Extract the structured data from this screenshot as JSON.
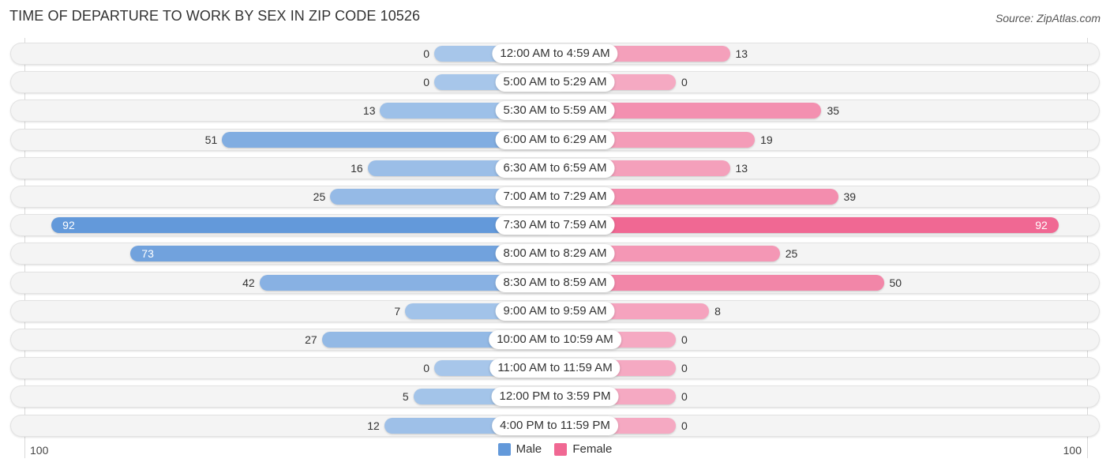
{
  "header": {
    "title": "TIME OF DEPARTURE TO WORK BY SEX IN ZIP CODE 10526",
    "source": "Source: ZipAtlas.com"
  },
  "colors": {
    "male_strong": "#6399da",
    "male_light": "#a7c6ea",
    "female_strong": "#f06893",
    "female_light": "#f5a9c2",
    "row_bg": "#f4f4f4"
  },
  "chart_data": {
    "type": "bar",
    "orientation": "horizontal-diverging",
    "title": "TIME OF DEPARTURE TO WORK BY SEX IN ZIP CODE 10526",
    "categories": [
      "12:00 AM to 4:59 AM",
      "5:00 AM to 5:29 AM",
      "5:30 AM to 5:59 AM",
      "6:00 AM to 6:29 AM",
      "6:30 AM to 6:59 AM",
      "7:00 AM to 7:29 AM",
      "7:30 AM to 7:59 AM",
      "8:00 AM to 8:29 AM",
      "8:30 AM to 8:59 AM",
      "9:00 AM to 9:59 AM",
      "10:00 AM to 10:59 AM",
      "11:00 AM to 11:59 AM",
      "12:00 PM to 3:59 PM",
      "4:00 PM to 11:59 PM"
    ],
    "series": [
      {
        "name": "Male",
        "values": [
          0,
          0,
          13,
          51,
          16,
          25,
          92,
          73,
          42,
          7,
          27,
          0,
          5,
          12
        ]
      },
      {
        "name": "Female",
        "values": [
          13,
          0,
          35,
          19,
          13,
          39,
          92,
          25,
          50,
          8,
          0,
          0,
          0,
          0
        ]
      }
    ],
    "axis": {
      "left_label": "100",
      "right_label": "100",
      "range": [
        0,
        100
      ]
    },
    "legend": {
      "position": "bottom-center",
      "entries": [
        "Male",
        "Female"
      ]
    },
    "xlabel": "",
    "ylabel": ""
  }
}
